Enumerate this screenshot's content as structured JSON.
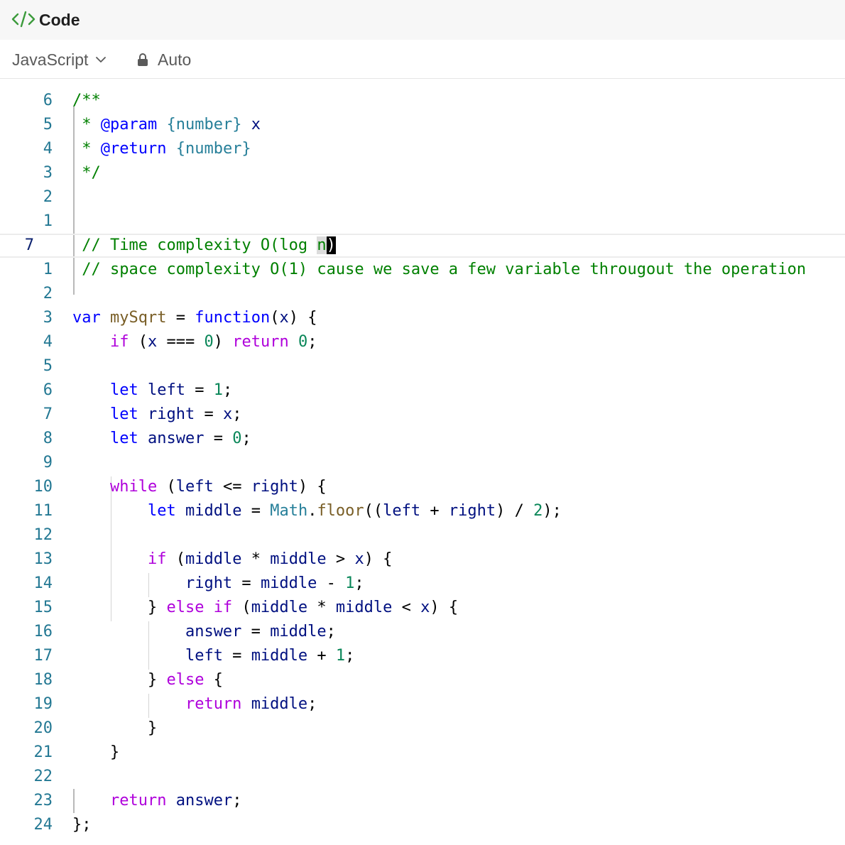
{
  "window": {
    "title": "Code"
  },
  "toolbar": {
    "language": "JavaScript",
    "mode": "Auto"
  },
  "editor": {
    "lines": [
      {
        "num": "6",
        "tokens": [
          [
            "/**",
            "com"
          ]
        ]
      },
      {
        "num": "5",
        "tokens": [
          [
            " * ",
            "com"
          ],
          [
            "@param",
            "doc"
          ],
          [
            " ",
            "com"
          ],
          [
            "{number}",
            "type"
          ],
          [
            " x",
            "var"
          ]
        ]
      },
      {
        "num": "4",
        "tokens": [
          [
            " * ",
            "com"
          ],
          [
            "@return",
            "doc"
          ],
          [
            " ",
            "com"
          ],
          [
            "{number}",
            "type"
          ]
        ]
      },
      {
        "num": "3",
        "tokens": [
          [
            " */",
            "com"
          ]
        ]
      },
      {
        "num": "2",
        "tokens": []
      },
      {
        "num": "1",
        "tokens": []
      },
      {
        "num": "7",
        "active": true,
        "tokens": [
          [
            " // Time complexity O(log ",
            "com"
          ],
          [
            "n",
            "com sel"
          ],
          [
            ")",
            "cur"
          ]
        ]
      },
      {
        "num": "1",
        "tokens": [
          [
            " // space complexity O(1) cause we save a few variable througout the operation",
            "com"
          ]
        ]
      },
      {
        "num": "2",
        "tokens": []
      },
      {
        "num": "3",
        "tokens": [
          [
            "var",
            "kw"
          ],
          [
            " ",
            ""
          ],
          [
            "mySqrt",
            "fn"
          ],
          [
            " = ",
            ""
          ],
          [
            "function",
            "kw"
          ],
          [
            "(",
            ""
          ],
          [
            "x",
            "var"
          ],
          [
            ") {",
            ""
          ]
        ]
      },
      {
        "num": "4",
        "tokens": [
          [
            "    ",
            ""
          ],
          [
            "if",
            "ctl"
          ],
          [
            " (",
            ""
          ],
          [
            "x",
            "var"
          ],
          [
            " === ",
            ""
          ],
          [
            "0",
            "num"
          ],
          [
            ") ",
            ""
          ],
          [
            "return",
            "ctl"
          ],
          [
            " ",
            ""
          ],
          [
            "0",
            "num"
          ],
          [
            ";",
            ""
          ]
        ]
      },
      {
        "num": "5",
        "tokens": []
      },
      {
        "num": "6",
        "tokens": [
          [
            "    ",
            ""
          ],
          [
            "let",
            "kw"
          ],
          [
            " ",
            ""
          ],
          [
            "left",
            "var"
          ],
          [
            " = ",
            ""
          ],
          [
            "1",
            "num"
          ],
          [
            ";",
            ""
          ]
        ]
      },
      {
        "num": "7",
        "tokens": [
          [
            "    ",
            ""
          ],
          [
            "let",
            "kw"
          ],
          [
            " ",
            ""
          ],
          [
            "right",
            "var"
          ],
          [
            " = ",
            ""
          ],
          [
            "x",
            "var"
          ],
          [
            ";",
            ""
          ]
        ]
      },
      {
        "num": "8",
        "tokens": [
          [
            "    ",
            ""
          ],
          [
            "let",
            "kw"
          ],
          [
            " ",
            ""
          ],
          [
            "answer",
            "var"
          ],
          [
            " = ",
            ""
          ],
          [
            "0",
            "num"
          ],
          [
            ";",
            ""
          ]
        ]
      },
      {
        "num": "9",
        "tokens": []
      },
      {
        "num": "10",
        "tokens": [
          [
            "    ",
            ""
          ],
          [
            "while",
            "ctl"
          ],
          [
            " (",
            ""
          ],
          [
            "left",
            "var"
          ],
          [
            " <= ",
            ""
          ],
          [
            "right",
            "var"
          ],
          [
            ") {",
            ""
          ]
        ]
      },
      {
        "num": "11",
        "tokens": [
          [
            "        ",
            ""
          ],
          [
            "let",
            "kw"
          ],
          [
            " ",
            ""
          ],
          [
            "middle",
            "var"
          ],
          [
            " = ",
            ""
          ],
          [
            "Math",
            "cls"
          ],
          [
            ".",
            ""
          ],
          [
            "floor",
            "fn"
          ],
          [
            "((",
            ""
          ],
          [
            "left",
            "var"
          ],
          [
            " + ",
            ""
          ],
          [
            "right",
            "var"
          ],
          [
            ") / ",
            ""
          ],
          [
            "2",
            "num"
          ],
          [
            ");",
            ""
          ]
        ]
      },
      {
        "num": "12",
        "tokens": []
      },
      {
        "num": "13",
        "tokens": [
          [
            "        ",
            ""
          ],
          [
            "if",
            "ctl"
          ],
          [
            " (",
            ""
          ],
          [
            "middle",
            "var"
          ],
          [
            " * ",
            ""
          ],
          [
            "middle",
            "var"
          ],
          [
            " > ",
            ""
          ],
          [
            "x",
            "var"
          ],
          [
            ") {",
            ""
          ]
        ]
      },
      {
        "num": "14",
        "tokens": [
          [
            "            ",
            ""
          ],
          [
            "right",
            "var"
          ],
          [
            " = ",
            ""
          ],
          [
            "middle",
            "var"
          ],
          [
            " - ",
            ""
          ],
          [
            "1",
            "num"
          ],
          [
            ";",
            ""
          ]
        ]
      },
      {
        "num": "15",
        "tokens": [
          [
            "        } ",
            ""
          ],
          [
            "else",
            "ctl"
          ],
          [
            " ",
            ""
          ],
          [
            "if",
            "ctl"
          ],
          [
            " (",
            ""
          ],
          [
            "middle",
            "var"
          ],
          [
            " * ",
            ""
          ],
          [
            "middle",
            "var"
          ],
          [
            " < ",
            ""
          ],
          [
            "x",
            "var"
          ],
          [
            ") {",
            ""
          ]
        ]
      },
      {
        "num": "16",
        "tokens": [
          [
            "            ",
            ""
          ],
          [
            "answer",
            "var"
          ],
          [
            " = ",
            ""
          ],
          [
            "middle",
            "var"
          ],
          [
            ";",
            ""
          ]
        ]
      },
      {
        "num": "17",
        "tokens": [
          [
            "            ",
            ""
          ],
          [
            "left",
            "var"
          ],
          [
            " = ",
            ""
          ],
          [
            "middle",
            "var"
          ],
          [
            " + ",
            ""
          ],
          [
            "1",
            "num"
          ],
          [
            ";",
            ""
          ]
        ]
      },
      {
        "num": "18",
        "tokens": [
          [
            "        } ",
            ""
          ],
          [
            "else",
            "ctl"
          ],
          [
            " {",
            ""
          ]
        ]
      },
      {
        "num": "19",
        "tokens": [
          [
            "            ",
            ""
          ],
          [
            "return",
            "ctl"
          ],
          [
            " ",
            ""
          ],
          [
            "middle",
            "var"
          ],
          [
            ";",
            ""
          ]
        ]
      },
      {
        "num": "20",
        "tokens": [
          [
            "        }",
            ""
          ]
        ]
      },
      {
        "num": "21",
        "tokens": [
          [
            "    }",
            ""
          ]
        ]
      },
      {
        "num": "22",
        "tokens": []
      },
      {
        "num": "23",
        "tokens": [
          [
            "    ",
            ""
          ],
          [
            "return",
            "ctl"
          ],
          [
            " ",
            ""
          ],
          [
            "answer",
            "var"
          ],
          [
            ";",
            ""
          ]
        ]
      },
      {
        "num": "24",
        "tokens": [
          [
            "};",
            ""
          ]
        ]
      }
    ]
  },
  "colors": {
    "comment": "#008000",
    "keyword": "#0000ff",
    "control": "#af00db",
    "function": "#795e26",
    "variable": "#001080",
    "number": "#098658",
    "type": "#267f99",
    "line_number": "#237893",
    "title_icon": "#3c9b3c"
  },
  "icons": {
    "title": "code-brackets-icon",
    "language_dropdown": "chevron-down-icon",
    "mode": "lock-icon"
  }
}
